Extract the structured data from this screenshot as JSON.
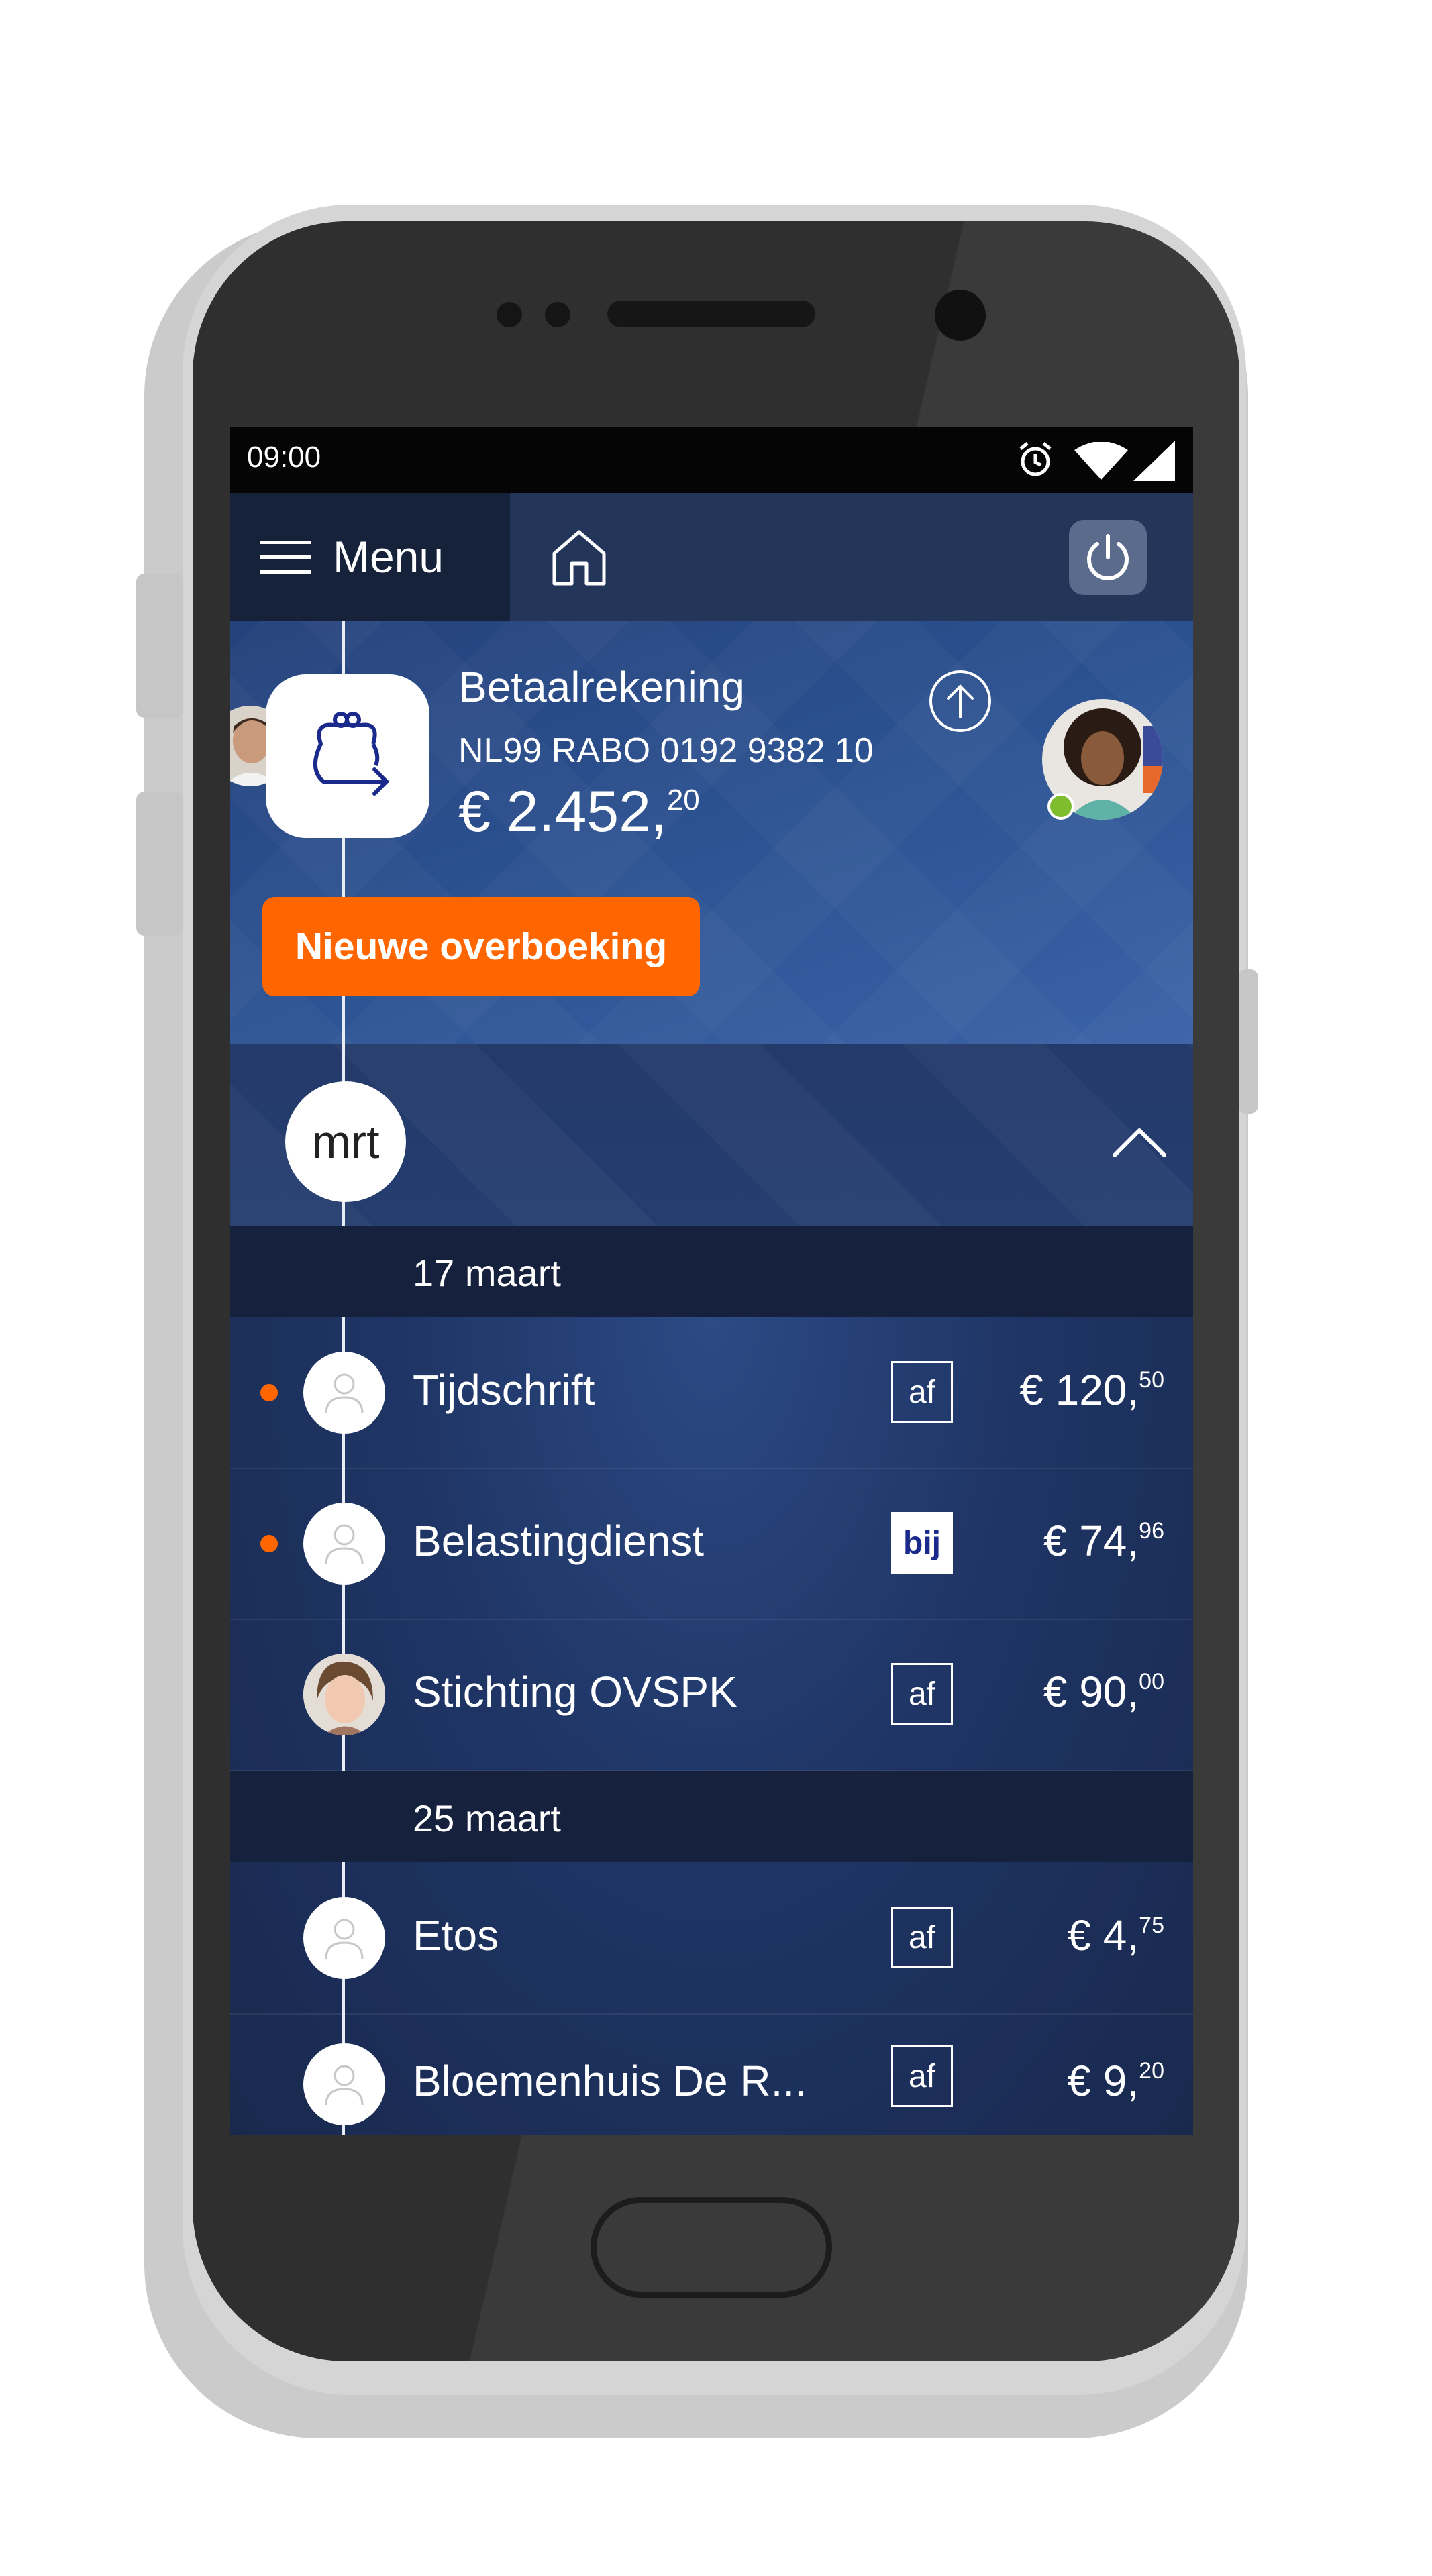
{
  "status_bar": {
    "time": "09:00"
  },
  "nav": {
    "menu_label": "Menu"
  },
  "account": {
    "name": "Betaalrekening",
    "iban": "NL99 RABO 0192 9382 10",
    "balance_main": "€ 2.452,",
    "balance_cents": "20",
    "new_transfer_label": "Nieuwe overboeking"
  },
  "month": {
    "label": "mrt"
  },
  "groups": [
    {
      "date": "17 maart"
    },
    {
      "date": "25 maart"
    }
  ],
  "transactions": [
    {
      "name": "Tijdschrift",
      "type": "af",
      "amount_main": "€ 120,",
      "amount_cents": "50",
      "unread": true
    },
    {
      "name": "Belastingdienst",
      "type": "bij",
      "amount_main": "€ 74,",
      "amount_cents": "96",
      "unread": true
    },
    {
      "name": "Stichting OVSPK",
      "type": "af",
      "amount_main": "€ 90,",
      "amount_cents": "00",
      "unread": false
    },
    {
      "name": "Etos",
      "type": "af",
      "amount_main": "€ 4,",
      "amount_cents": "75",
      "unread": false
    },
    {
      "name": "Bloemenhuis De R...",
      "type": "af",
      "amount_main": "€ 9,",
      "amount_cents": "20",
      "unread": false
    }
  ],
  "colors": {
    "accent": "#ff6600",
    "nav": "#233559",
    "online": "#7fbc2e",
    "bij_text": "#1a2a8c"
  }
}
